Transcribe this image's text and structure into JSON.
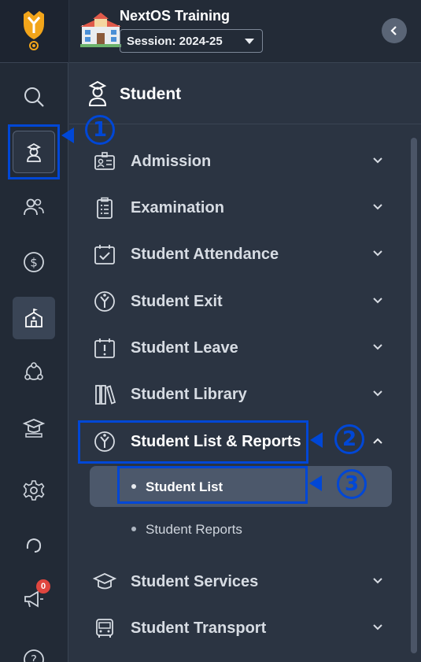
{
  "header": {
    "org_name": "NextOS Training",
    "session_value": "Session: 2024-25"
  },
  "section": {
    "title": "Student"
  },
  "rail": {
    "items": [
      {
        "name": "search-icon"
      },
      {
        "name": "student-icon"
      },
      {
        "name": "users-icon"
      },
      {
        "name": "dollar-icon"
      },
      {
        "name": "school-icon"
      },
      {
        "name": "network-icon"
      },
      {
        "name": "graduation-icon"
      },
      {
        "name": "gear-icon"
      },
      {
        "name": "support-icon"
      },
      {
        "name": "megaphone-icon"
      },
      {
        "name": "help-icon"
      }
    ],
    "notification_count": "0"
  },
  "menu": {
    "items": [
      {
        "label": "Admission"
      },
      {
        "label": "Examination"
      },
      {
        "label": "Student Attendance"
      },
      {
        "label": "Student Exit"
      },
      {
        "label": "Student Leave"
      },
      {
        "label": "Student Library"
      },
      {
        "label": "Student List & Reports"
      },
      {
        "label": "Student Services"
      },
      {
        "label": "Student Transport"
      }
    ],
    "subitems": [
      {
        "label": "Student List"
      },
      {
        "label": "Student Reports"
      }
    ]
  },
  "annotations": {
    "step1": "1",
    "step2": "2",
    "step3": "3"
  },
  "colors": {
    "annotation": "#0047d6",
    "sidebar_bg": "#2b3442",
    "active_bg": "#4c586b"
  }
}
